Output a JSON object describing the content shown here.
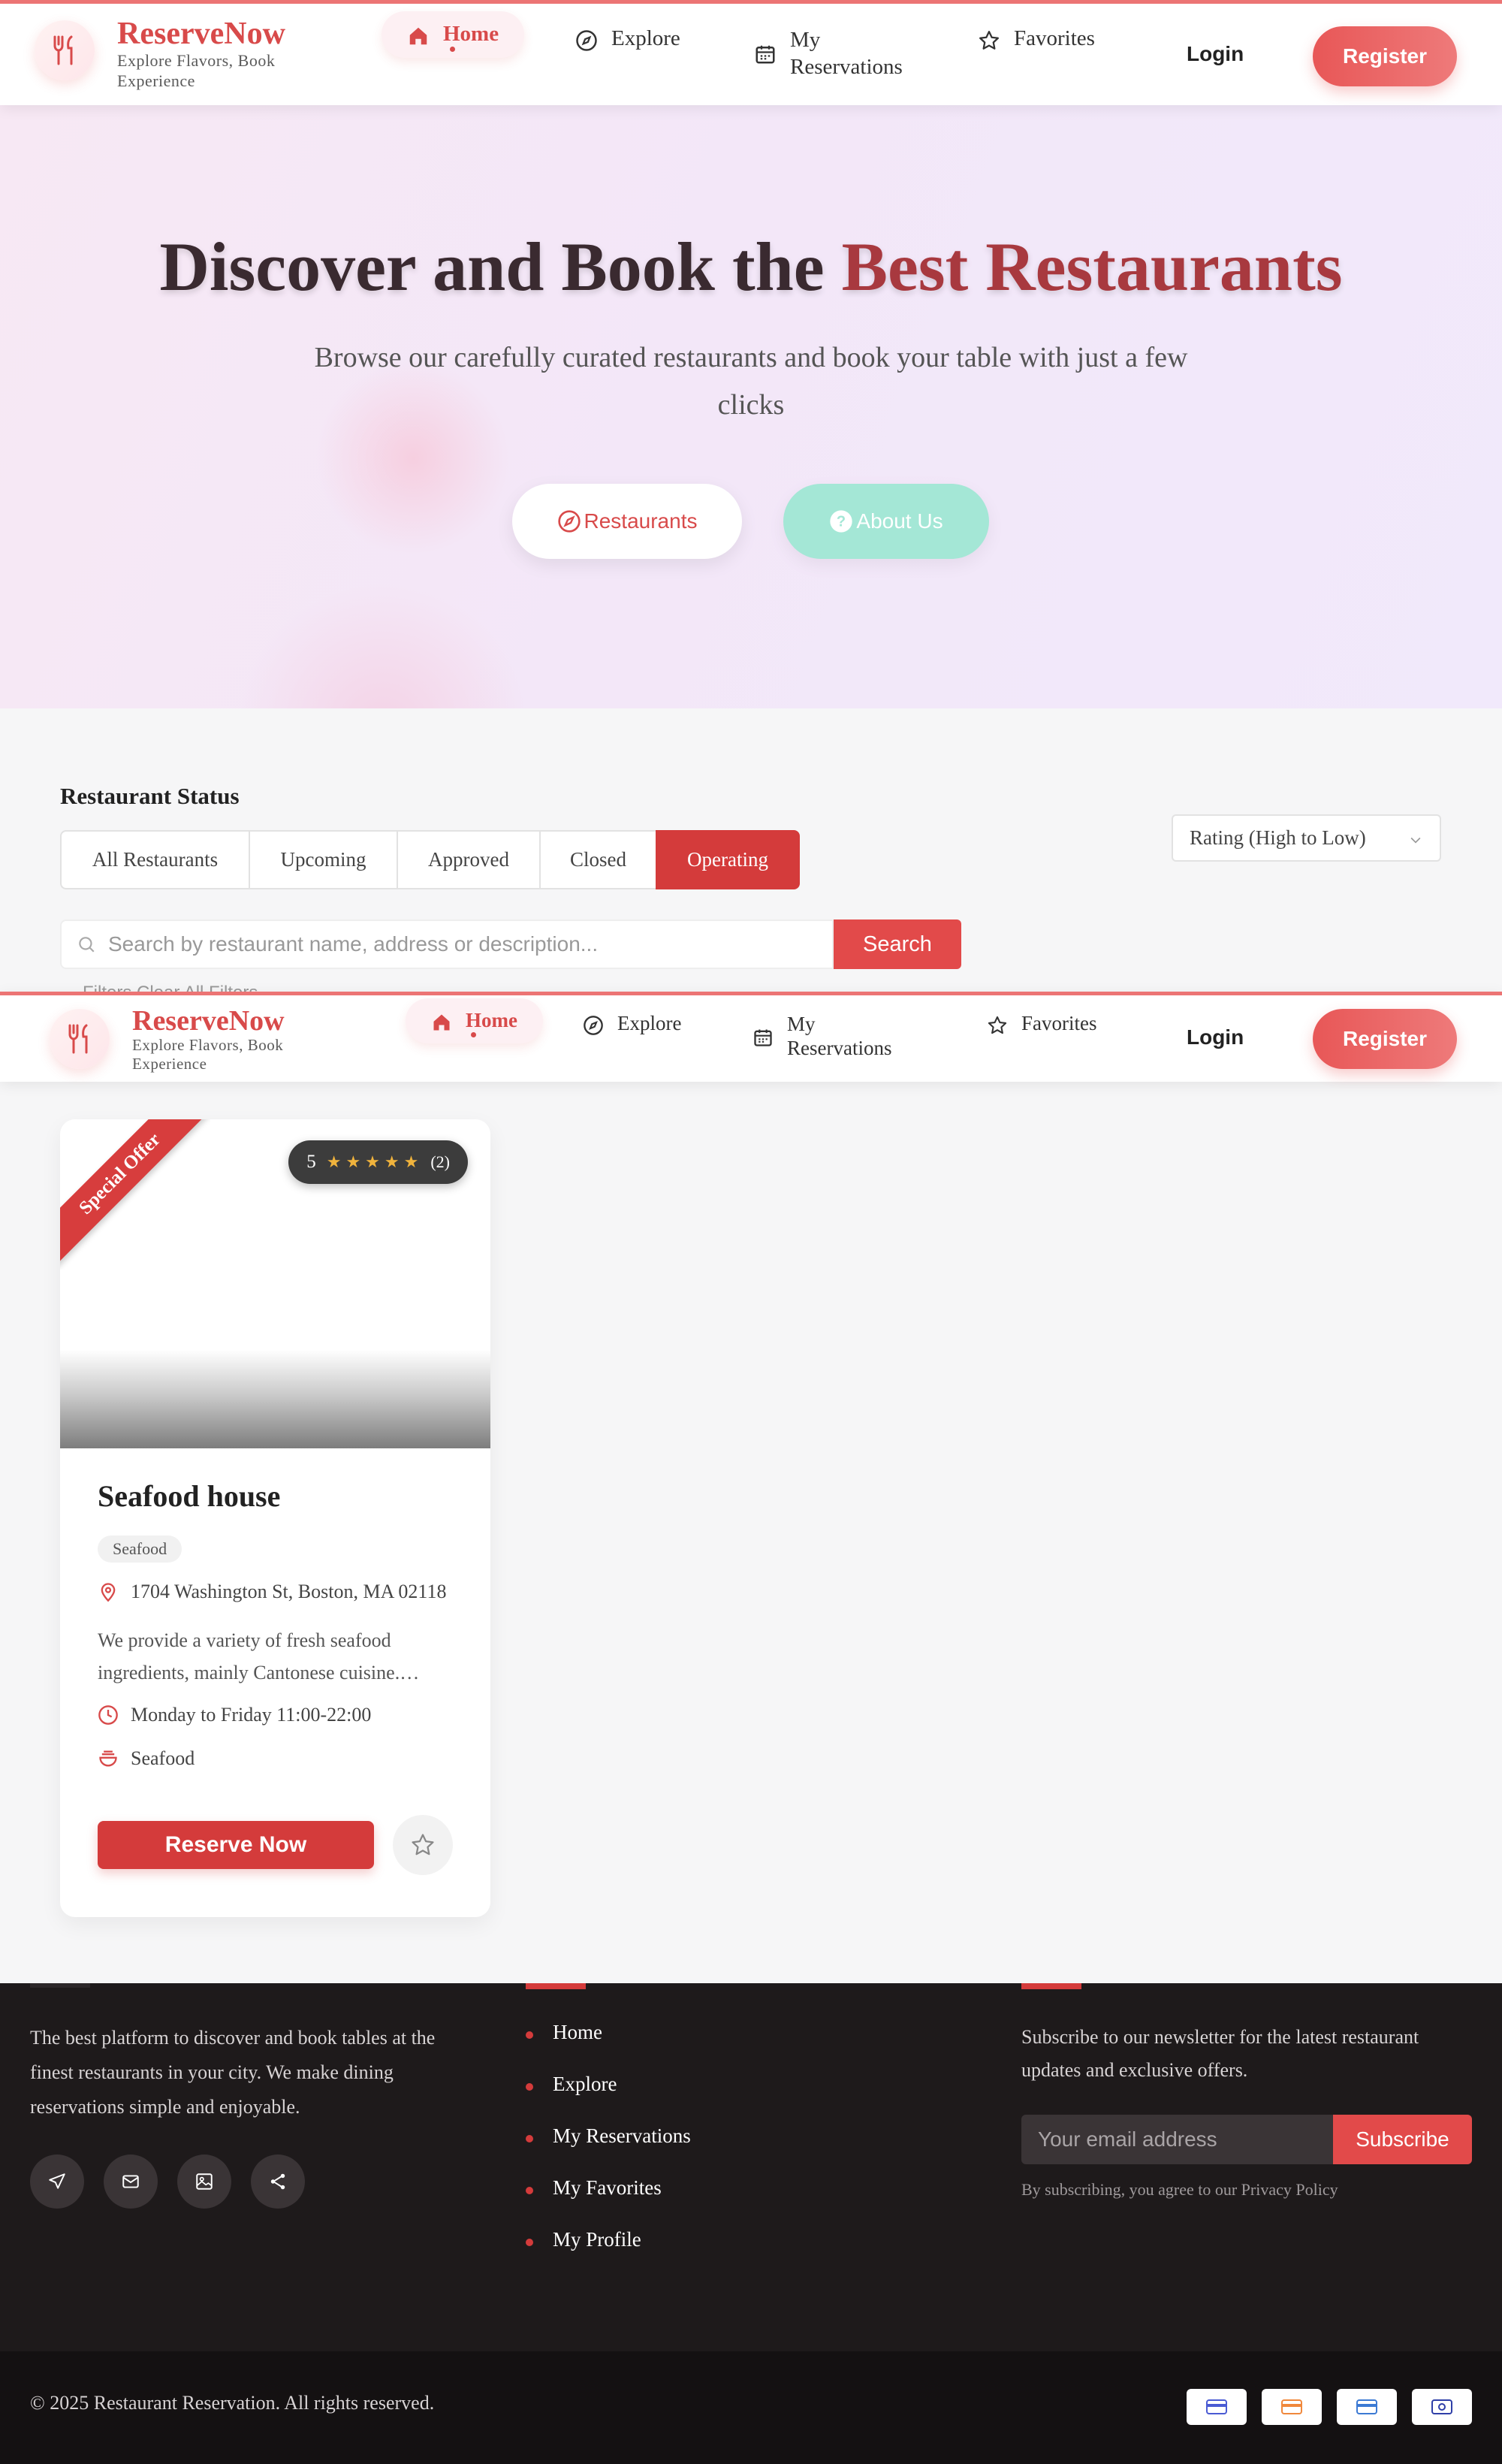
{
  "brand": {
    "name": "ReserveNow",
    "tagline": "Explore Flavors, Book Experience"
  },
  "nav": {
    "home": "Home",
    "explore": "Explore",
    "reservations_line1": "My",
    "reservations_line2": "Reservations",
    "favorites": "Favorites",
    "login": "Login",
    "register": "Register"
  },
  "hero": {
    "title_part1": "Discover and Book the ",
    "title_accent": "Best Restaurants",
    "subtitle": "Browse our carefully curated restaurants and book your table with just a few clicks",
    "btn_restaurants": "Restaurants",
    "btn_about": "About Us"
  },
  "filters": {
    "section_title": "Restaurant Status",
    "tabs": [
      "All Restaurants",
      "Upcoming",
      "Approved",
      "Closed",
      "Operating"
    ],
    "active_tab": "Operating",
    "sort_selected": "Rating (High to Low)",
    "search_placeholder": "Search by restaurant name, address or description...",
    "search_button": "Search",
    "clipped_text": "Filters  Clear All Filters"
  },
  "restaurant": {
    "ribbon": "Special Offer",
    "rating": "5",
    "stars": "★★★★★",
    "review_count": "(2)",
    "name": "Seafood house",
    "category": "Seafood",
    "address": "1704 Washington St, Boston, MA 02118",
    "description": "We provide a variety of fresh seafood ingredients, mainly Cantonese cuisine.…",
    "hours": "Monday to Friday 11:00-22:00",
    "cuisine": "Seafood",
    "reserve_label": "Reserve Now"
  },
  "footer": {
    "about": "The best platform to discover and book tables at the finest restaurants in your city. We make dining reservations simple and enjoyable.",
    "links": [
      "Home",
      "Explore",
      "My Reservations",
      "My Favorites",
      "My Profile"
    ],
    "newsletter_text": "Subscribe to our newsletter for the latest restaurant updates and exclusive offers.",
    "email_placeholder": "Your email address",
    "subscribe": "Subscribe",
    "note": "By subscribing, you agree to our Privacy Policy",
    "copyright": "© 2025 Restaurant Reservation. All rights reserved."
  },
  "colors": {
    "accent": "#d84a4a",
    "active_tab": "#d43b3b",
    "about_button": "#a4e7d6",
    "footer_bg": "#1e1a1b"
  },
  "icons": [
    "utensils-icon",
    "home-icon",
    "compass-icon",
    "calendar-icon",
    "star-icon",
    "search-icon",
    "chevron-down-icon",
    "map-pin-icon",
    "clock-icon",
    "bowl-icon",
    "send-icon",
    "mail-icon",
    "image-icon",
    "share-icon",
    "credit-card-icon"
  ]
}
